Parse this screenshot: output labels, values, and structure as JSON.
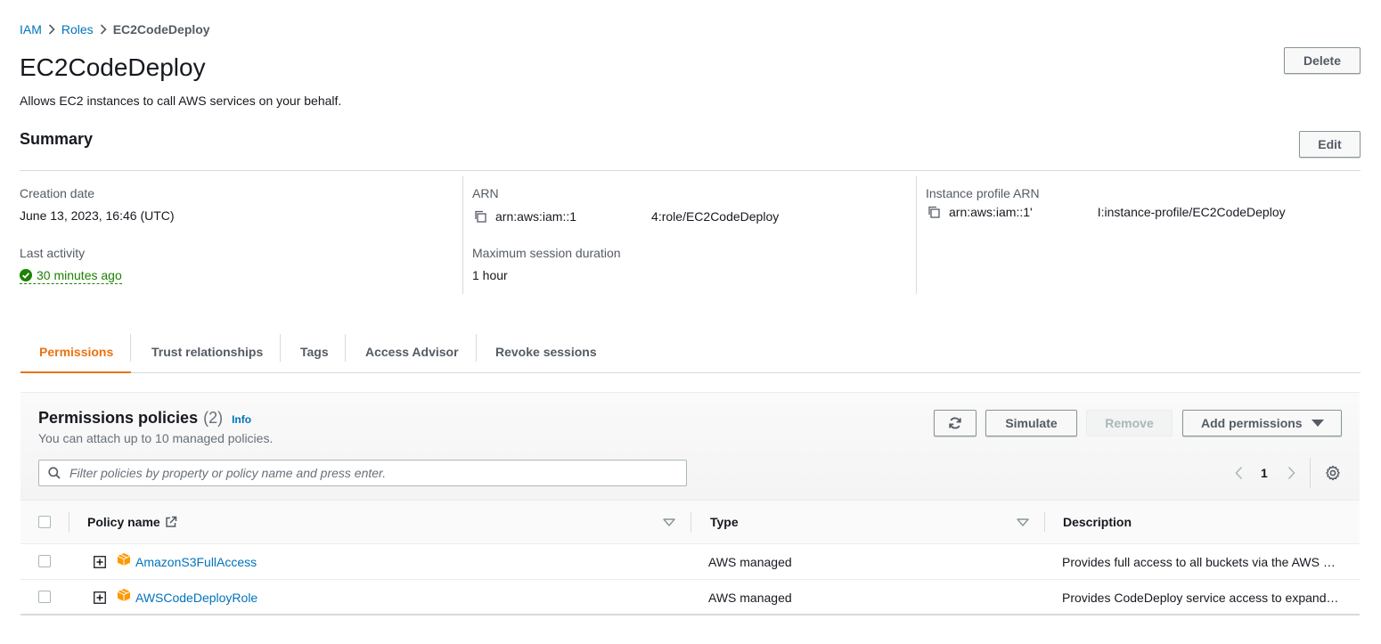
{
  "breadcrumb": {
    "items": [
      {
        "label": "IAM"
      },
      {
        "label": "Roles"
      },
      {
        "label": "EC2CodeDeploy"
      }
    ]
  },
  "header": {
    "title": "EC2CodeDeploy",
    "description": "Allows EC2 instances to call AWS services on your behalf.",
    "delete_label": "Delete"
  },
  "summary": {
    "title": "Summary",
    "edit_label": "Edit",
    "creation_date_label": "Creation date",
    "creation_date_value": "June 13, 2023, 16:46 (UTC)",
    "last_activity_label": "Last activity",
    "last_activity_value": "30 minutes ago",
    "arn_label": "ARN",
    "arn_value_prefix": "arn:aws:iam::1",
    "arn_value_suffix": "4:role/EC2CodeDeploy",
    "max_session_label": "Maximum session duration",
    "max_session_value": "1 hour",
    "instance_profile_label": "Instance profile ARN",
    "instance_profile_prefix": "arn:aws:iam::1'",
    "instance_profile_suffix": "I:instance-profile/EC2CodeDeploy"
  },
  "tabs": [
    {
      "label": "Permissions",
      "active": true
    },
    {
      "label": "Trust relationships",
      "active": false
    },
    {
      "label": "Tags",
      "active": false
    },
    {
      "label": "Access Advisor",
      "active": false
    },
    {
      "label": "Revoke sessions",
      "active": false
    }
  ],
  "permissions": {
    "title": "Permissions policies",
    "count": "(2)",
    "info_label": "Info",
    "subtitle": "You can attach up to 10 managed policies.",
    "refresh_icon": "refresh-icon",
    "simulate_label": "Simulate",
    "remove_label": "Remove",
    "add_permissions_label": "Add permissions",
    "search_placeholder": "Filter policies by property or policy name and press enter.",
    "page_number": "1",
    "columns": {
      "policy_name": "Policy name",
      "type": "Type",
      "description": "Description"
    },
    "rows": [
      {
        "name": "AmazonS3FullAccess",
        "type": "AWS managed",
        "description": "Provides full access to all buckets via the AWS …"
      },
      {
        "name": "AWSCodeDeployRole",
        "type": "AWS managed",
        "description": "Provides CodeDeploy service access to expand…"
      }
    ]
  },
  "colors": {
    "link": "#0073bb",
    "accent": "#ec7211",
    "success": "#1d8102",
    "policy_icon": "#f90"
  }
}
